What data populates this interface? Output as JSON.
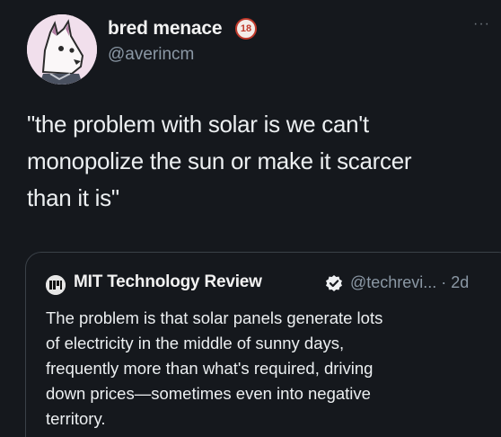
{
  "tweet": {
    "author": {
      "display_name": "bred menace",
      "handle": "@averincm",
      "badge": "18",
      "avatar_icon": "cartoon-wolf-avatar"
    },
    "more_icon": "ellipsis-icon",
    "more_label": "···",
    "text_lines": [
      "\"the problem with solar is we can't",
      "monopolize the sun or make it scarcer",
      "than it is\""
    ]
  },
  "quote": {
    "author": {
      "display_name": "MIT Technology Review",
      "handle_and_time": "@techrevi... · 2d",
      "logo_icon": "mit-tr-logo",
      "verified_icon": "verified-badge-icon"
    },
    "text_lines": [
      "The problem is that solar panels generate lots",
      "of electricity in the middle of sunny days,",
      "frequently more than what's required, driving",
      "down prices—sometimes even into negative",
      "territory."
    ]
  },
  "colors": {
    "background": "#15181d",
    "primary_text": "#eceff1",
    "secondary_text": "#8b98a5",
    "quote_border": "#3a4148",
    "badge_red": "#c0392b"
  }
}
